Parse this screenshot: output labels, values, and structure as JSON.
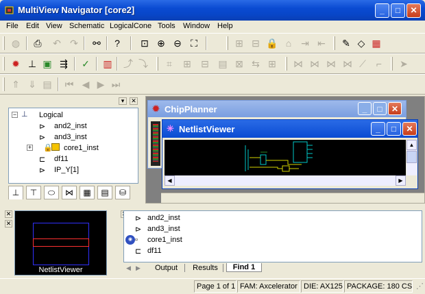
{
  "window": {
    "title": "MultiView Navigator [core2]"
  },
  "menu": [
    "File",
    "Edit",
    "View",
    "Schematic",
    "LogicalCone",
    "Tools",
    "Window",
    "Help"
  ],
  "tree": {
    "root": "Logical",
    "items": [
      "and2_inst",
      "and3_inst",
      "core1_inst",
      "df11",
      "IP_Y[1]"
    ]
  },
  "chipplanner": {
    "title": "ChipPlanner"
  },
  "netlistviewer": {
    "title": "NetlistViewer"
  },
  "mini_view": {
    "label": "NetlistViewer"
  },
  "output_list": {
    "items": [
      "and2_inst",
      "and3_inst",
      "core1_inst",
      "df11"
    ]
  },
  "bottom_tabs": [
    "Output",
    "Results",
    "Find 1"
  ],
  "status": {
    "page": "Page 1 of 1",
    "fam": "FAM: Axcelerator",
    "die": "DIE: AX125",
    "package": "PACKAGE: 180 CS"
  },
  "colors": {
    "title_blue": "#0a4bd2",
    "panel_bg": "#ece9d8"
  }
}
